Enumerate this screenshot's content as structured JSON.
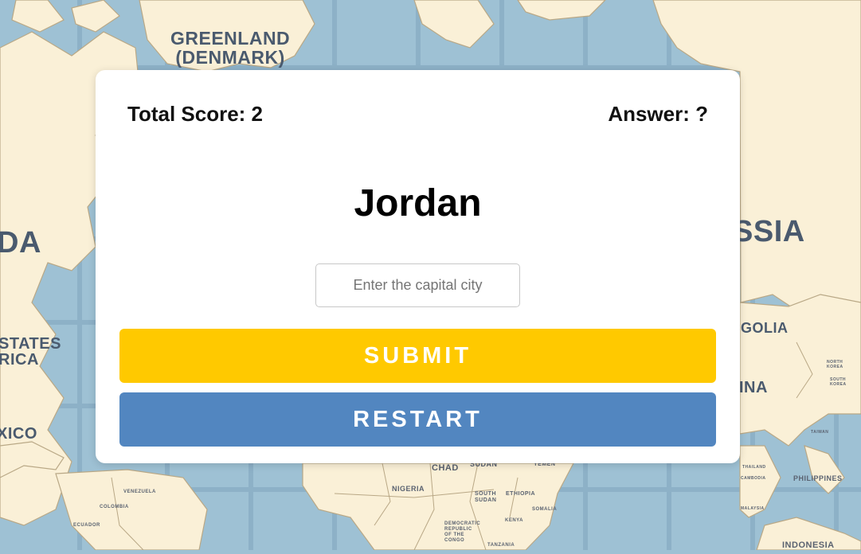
{
  "map": {
    "labels": {
      "greenland": "GREENLAND\n(DENMARK)",
      "canada": "DA",
      "united_states": "STATES\nRICA",
      "mexico": "XICO",
      "russia": "SSIA",
      "mongolia": "GOLIA",
      "china": "INA",
      "chad": "CHAD",
      "sudan": "SUDAN",
      "yemen": "YEMEN",
      "nigeria": "NIGERIA",
      "south_sudan": "SOUTH SUDAN",
      "ethiopia": "ETHIOPIA",
      "somalia": "SOMALIA",
      "kenya": "KENYA",
      "tanzania": "TANZANIA",
      "drc": "DEMOCRATIC REPUBLIC OF THE CONGO",
      "venezuela": "VENEZUELA",
      "colombia": "COLOMBIA",
      "ecuador": "ECUADOR",
      "philippines": "PHILIPPINES",
      "indonesia": "INDONESIA",
      "taiwan": "TAIWAN",
      "north_korea": "NORTH KOREA",
      "south_korea": "SOUTH KOREA",
      "thailand": "THAILAND",
      "cambodia": "CAMBODIA",
      "malaysia": "MALAYSIA"
    },
    "colors": {
      "ocean": "#9ec1d4",
      "land": "#faf0d7",
      "border": "#b9a886",
      "grid": "#7ea5bd"
    }
  },
  "game": {
    "score_label": "Total Score: 2",
    "answer_label": "Answer: ?",
    "country": "Jordan",
    "input": {
      "value": "",
      "placeholder": "Enter the capital city"
    },
    "submit_label": "SUBMIT",
    "restart_label": "RESTART"
  },
  "colors": {
    "submit": "#ffc900",
    "restart": "#5286c0",
    "card": "#ffffff"
  }
}
